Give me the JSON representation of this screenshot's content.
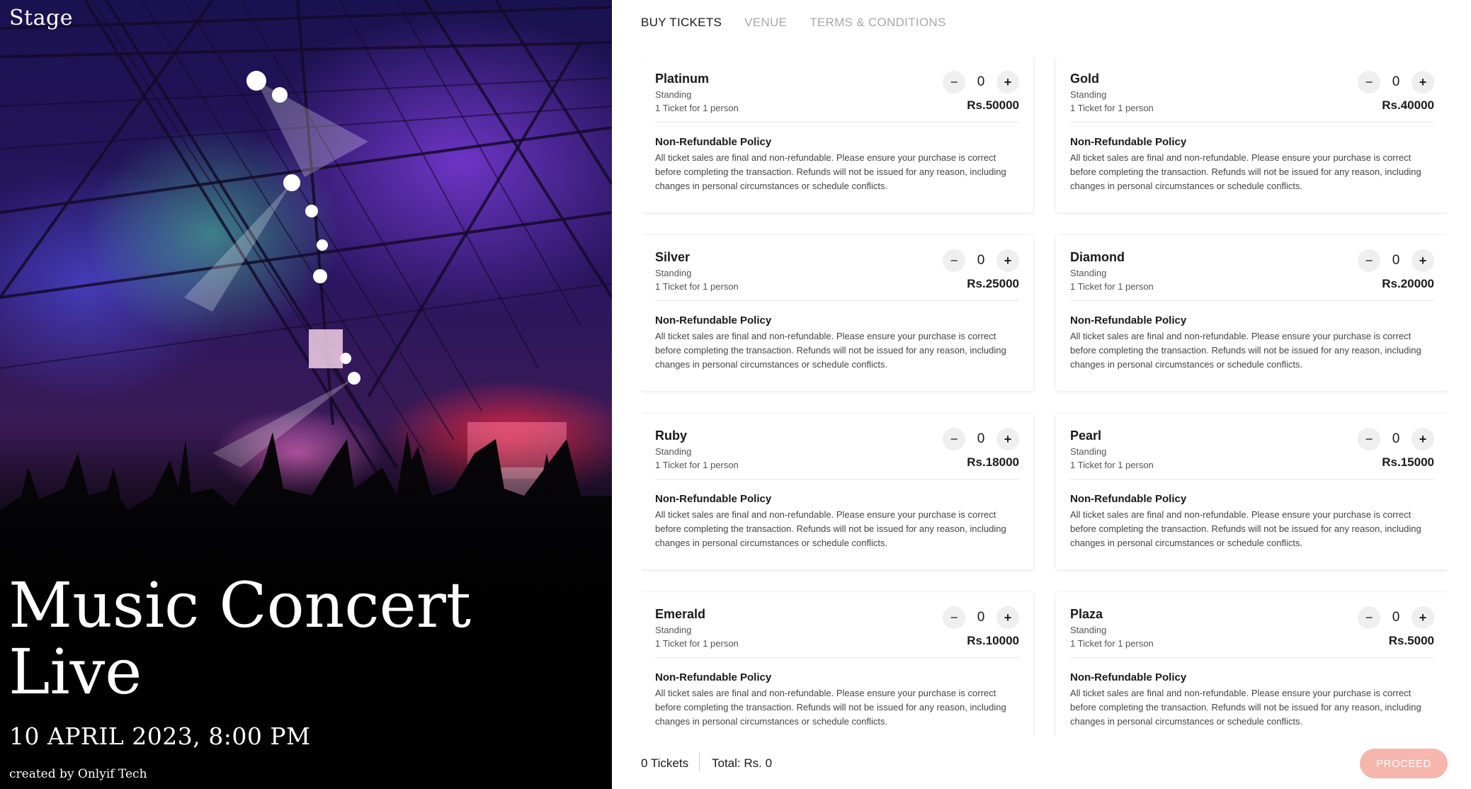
{
  "hero": {
    "brand": "Stage",
    "title": "Music Concert Live",
    "date": "10 APRIL 2023, 8:00 PM",
    "credit": "created by Onlyif Tech"
  },
  "tabs": [
    {
      "label": "BUY TICKETS",
      "active": true
    },
    {
      "label": "VENUE",
      "active": false
    },
    {
      "label": "TERMS & CONDITIONS",
      "active": false
    }
  ],
  "tickets": [
    {
      "name": "Platinum",
      "type": "Standing",
      "desc": "1 Ticket for 1 person",
      "qty": "0",
      "price": "Rs.50000",
      "policy_title": "Non-Refundable Policy",
      "policy_text": "All ticket sales are final and non-refundable. Please ensure your purchase is correct before completing the transaction. Refunds will not be issued for any reason, including changes in personal circumstances or schedule conflicts."
    },
    {
      "name": "Gold",
      "type": "Standing",
      "desc": "1 Ticket for 1 person",
      "qty": "0",
      "price": "Rs.40000",
      "policy_title": "Non-Refundable Policy",
      "policy_text": "All ticket sales are final and non-refundable. Please ensure your purchase is correct before completing the transaction. Refunds will not be issued for any reason, including changes in personal circumstances or schedule conflicts."
    },
    {
      "name": "Silver",
      "type": "Standing",
      "desc": "1 Ticket for 1 person",
      "qty": "0",
      "price": "Rs.25000",
      "policy_title": "Non-Refundable Policy",
      "policy_text": "All ticket sales are final and non-refundable. Please ensure your purchase is correct before completing the transaction. Refunds will not be issued for any reason, including changes in personal circumstances or schedule conflicts."
    },
    {
      "name": "Diamond",
      "type": "Standing",
      "desc": "1 Ticket for 1 person",
      "qty": "0",
      "price": "Rs.20000",
      "policy_title": "Non-Refundable Policy",
      "policy_text": "All ticket sales are final and non-refundable. Please ensure your purchase is correct before completing the transaction. Refunds will not be issued for any reason, including changes in personal circumstances or schedule conflicts."
    },
    {
      "name": "Ruby",
      "type": "Standing",
      "desc": "1 Ticket for 1 person",
      "qty": "0",
      "price": "Rs.18000",
      "policy_title": "Non-Refundable Policy",
      "policy_text": "All ticket sales are final and non-refundable. Please ensure your purchase is correct before completing the transaction. Refunds will not be issued for any reason, including changes in personal circumstances or schedule conflicts."
    },
    {
      "name": "Pearl",
      "type": "Standing",
      "desc": "1 Ticket for 1 person",
      "qty": "0",
      "price": "Rs.15000",
      "policy_title": "Non-Refundable Policy",
      "policy_text": "All ticket sales are final and non-refundable. Please ensure your purchase is correct before completing the transaction. Refunds will not be issued for any reason, including changes in personal circumstances or schedule conflicts."
    },
    {
      "name": "Emerald",
      "type": "Standing",
      "desc": "1 Ticket for 1 person",
      "qty": "0",
      "price": "Rs.10000",
      "policy_title": "Non-Refundable Policy",
      "policy_text": "All ticket sales are final and non-refundable. Please ensure your purchase is correct before completing the transaction. Refunds will not be issued for any reason, including changes in personal circumstances or schedule conflicts."
    },
    {
      "name": "Plaza",
      "type": "Standing",
      "desc": "1 Ticket for 1 person",
      "qty": "0",
      "price": "Rs.5000",
      "policy_title": "Non-Refundable Policy",
      "policy_text": "All ticket sales are final and non-refundable. Please ensure your purchase is correct before completing the transaction. Refunds will not be issued for any reason, including changes in personal circumstances or schedule conflicts."
    }
  ],
  "stepper": {
    "minus_label": "−",
    "plus_label": "+"
  },
  "footer": {
    "tickets_label": "0 Tickets",
    "total_label": "Total: Rs. 0",
    "proceed_label": "PROCEED"
  },
  "colors": {
    "accent_disabled": "#f6b6ad",
    "tab_active": "#1a1a1a",
    "tab_inactive": "#a8a8a8",
    "step_button_bg": "#efefef"
  },
  "icons": {
    "minus": "minus-icon",
    "plus": "plus-icon"
  }
}
